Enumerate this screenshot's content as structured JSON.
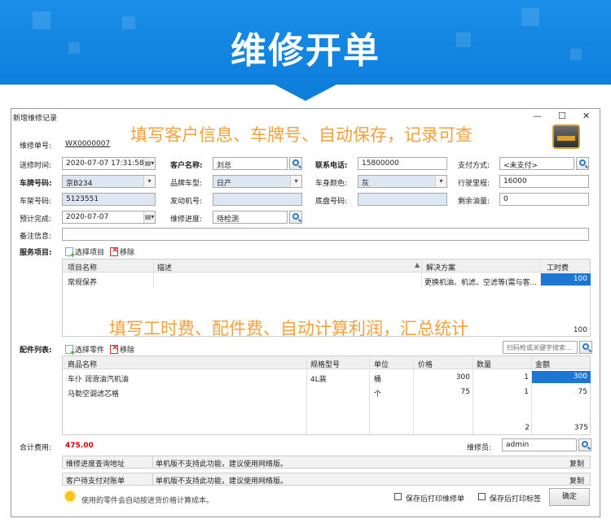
{
  "banner": {
    "title": "维修开单"
  },
  "window": {
    "title": "新增维修记录",
    "minimize": "—",
    "maximize": "☐",
    "close": "✕"
  },
  "annotations": {
    "top": "填写客户信息、车牌号、自动保存，记录可查",
    "middle": "填写工时费、配件费、自动计算利润，汇总统计"
  },
  "form": {
    "order_no_label": "维修单号:",
    "order_no": "WX0000007",
    "send_time_label": "送修时间:",
    "send_time": "2020-07-07 17:31:58",
    "customer_label": "客户名称:",
    "customer": "刘总",
    "phone_label": "联系电话:",
    "phone": "15800000",
    "payment_label": "支付方式:",
    "payment": "<未支付>",
    "plate_label": "车牌号码:",
    "plate": "京B234",
    "brand_label": "品牌车型:",
    "brand": "日产",
    "color_label": "车身颜色:",
    "color": "灰",
    "mileage_label": "行驶里程:",
    "mileage": "16000",
    "frame_label": "车架号码:",
    "frame": "5123551",
    "engine_label": "发动机号:",
    "engine": "",
    "chassis_label": "底盘号码:",
    "chassis": "",
    "fuel_label": "剩余油量:",
    "fuel": "0",
    "finish_label": "预计完成:",
    "finish": "2020-07-07",
    "progress_label": "维修进度:",
    "progress": "待检测",
    "remark_label": "备注信息:",
    "remark": ""
  },
  "services": {
    "label": "服务项目:",
    "select_btn": "选择项目",
    "remove_btn": "移除",
    "columns": [
      "项目名称",
      "描述",
      "解决方案",
      "工时费"
    ],
    "rows": [
      {
        "name": "常规保养",
        "desc": "",
        "solution": "更换机油、机滤、空滤等(需与客...",
        "fee": "100"
      }
    ],
    "total": "100"
  },
  "parts": {
    "label": "配件列表:",
    "select_btn": "选择零件",
    "remove_btn": "移除",
    "search_placeholder": "扫码枪或关键字搜索...",
    "columns": [
      "商品名称",
      "规格型号",
      "单位",
      "价格",
      "数量",
      "金额"
    ],
    "rows": [
      {
        "name": "车仆 润滑油汽机油",
        "spec": "4L装",
        "unit": "桶",
        "price": "300",
        "qty": "1",
        "amount": "300"
      },
      {
        "name": "马勒空调滤芯格",
        "spec": "",
        "unit": "个",
        "price": "75",
        "qty": "1",
        "amount": "75"
      }
    ],
    "total_qty": "2",
    "total_amount": "375"
  },
  "footer": {
    "total_label": "合计费用:",
    "total": "475.00",
    "mechanic_label": "维修员:",
    "mechanic": "admin",
    "query_label": "维修进度查询地址",
    "query_text": "单机版不支持此功能，建议使用网络版。",
    "pay_label": "客户待支付对账单",
    "pay_text": "单机版不支持此功能，建议使用网络版。",
    "copy": "复制",
    "tip": "使用的零件会自动按进货价格计算成本。",
    "print_order": "保存后打印维修单",
    "print_label": "保存后打印标签",
    "confirm": "确定"
  },
  "colors": {
    "banner": "#0f7fdc",
    "annotation": "#f3a13a",
    "total": "#d40000",
    "selection": "#1d77d2"
  }
}
